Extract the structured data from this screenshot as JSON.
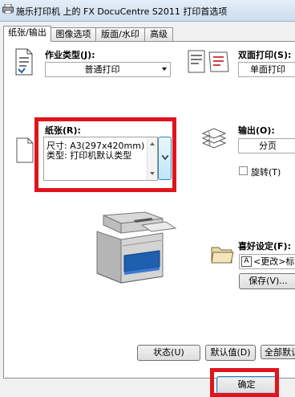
{
  "window": {
    "title": "施乐打印机 上的 FX DocuCentre S2011 打印首选项"
  },
  "tabs": [
    {
      "label": "纸张/输出"
    },
    {
      "label": "图像选项"
    },
    {
      "label": "版面/水印"
    },
    {
      "label": "高级"
    }
  ],
  "job_type": {
    "label": "作业类型(J):",
    "value": "普通打印"
  },
  "duplex": {
    "label": "双面打印(S):",
    "value": "单面打印"
  },
  "paper": {
    "label": "纸张(R):",
    "size_line": "尺寸: A3(297x420mm)",
    "type_line": "类型: 打印机默认类型"
  },
  "output": {
    "label": "输出(O):",
    "value": "分页"
  },
  "rotate": {
    "label": "旋转(T)"
  },
  "favorites": {
    "label": "喜好设定(F):",
    "value": "<更改>标准",
    "save_label": "保存(V)..."
  },
  "buttons": {
    "status": "状态(U)",
    "defaults": "默认值(D)",
    "all_defaults": "全部默认值",
    "ok": "确定"
  },
  "colors": {
    "highlight": "#e0141c",
    "printer_tray": "#1f5fb0"
  }
}
